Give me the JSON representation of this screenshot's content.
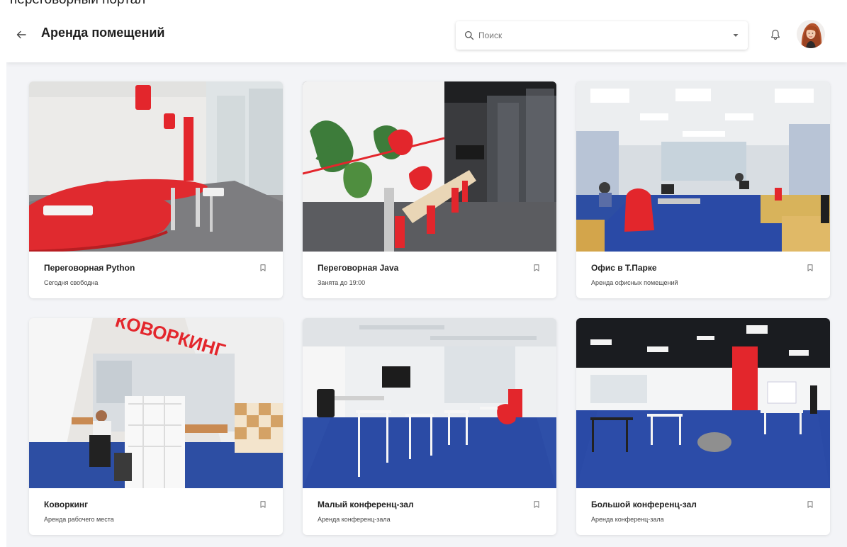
{
  "top_clipped_text": "переговорный портал",
  "appbar": {
    "title": "Аренда помещений",
    "back_icon": "arrow-left-icon",
    "search": {
      "placeholder": "Поиск",
      "value": "",
      "icon": "search-icon"
    },
    "notifications_icon": "bell-icon",
    "avatar_icon": "user-avatar"
  },
  "colors": {
    "accent_red": "#e3262c",
    "carpet_blue": "#2a4aa6",
    "background": "#f3f4f7"
  },
  "cards": [
    {
      "title": "Переговорная Python",
      "subtitle": "Сегодня свободна",
      "bookmark_icon": "bookmark-icon"
    },
    {
      "title": "Переговорная Java",
      "subtitle": "Занята до 19:00",
      "bookmark_icon": "bookmark-icon"
    },
    {
      "title": "Офис в Т.Парке",
      "subtitle": "Аренда офисных помещений",
      "bookmark_icon": "bookmark-icon"
    },
    {
      "title": "Коворкинг",
      "subtitle": "Аренда рабочего места",
      "bookmark_icon": "bookmark-icon",
      "image_text": "КОВОРКИНГ"
    },
    {
      "title": "Малый конференц-зал",
      "subtitle": "Аренда конференц-зала",
      "bookmark_icon": "bookmark-icon"
    },
    {
      "title": "Большой конференц-зал",
      "subtitle": "Аренда конференц-зала",
      "bookmark_icon": "bookmark-icon"
    }
  ]
}
